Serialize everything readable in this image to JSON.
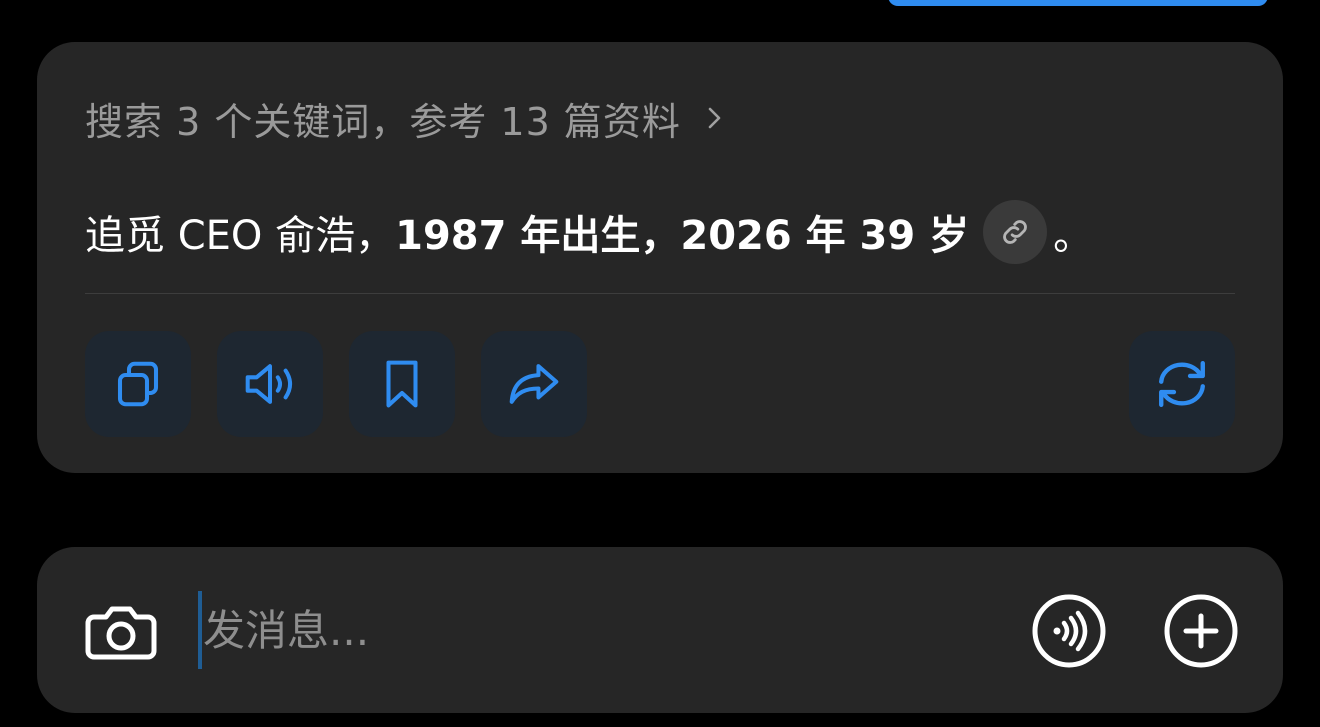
{
  "theme": {
    "background": "#000000",
    "card": "#262626",
    "accent": "#2f8cf0",
    "icon_blue": "#2f8cf0",
    "muted_text": "#9a9a9a"
  },
  "answer_card": {
    "search_summary": "搜索 3 个关键词，参考 13 篇资料",
    "summary_icon": "chevron-right-icon",
    "answer_segments": {
      "part1": "追觅 CEO 俞浩，",
      "part2": "1987 年出生，2026 年 39 岁",
      "part3": "。"
    },
    "source_link_icon": "link-icon",
    "actions": [
      {
        "name": "copy",
        "icon": "copy-icon"
      },
      {
        "name": "read-aloud",
        "icon": "speaker-icon"
      },
      {
        "name": "bookmark",
        "icon": "bookmark-icon"
      },
      {
        "name": "share",
        "icon": "share-icon"
      },
      {
        "name": "regenerate",
        "icon": "refresh-icon"
      }
    ]
  },
  "composer": {
    "placeholder": "发消息...",
    "value": "",
    "left_icon": "camera-icon",
    "voice_icon": "voice-call-icon",
    "add_icon": "plus-icon"
  }
}
